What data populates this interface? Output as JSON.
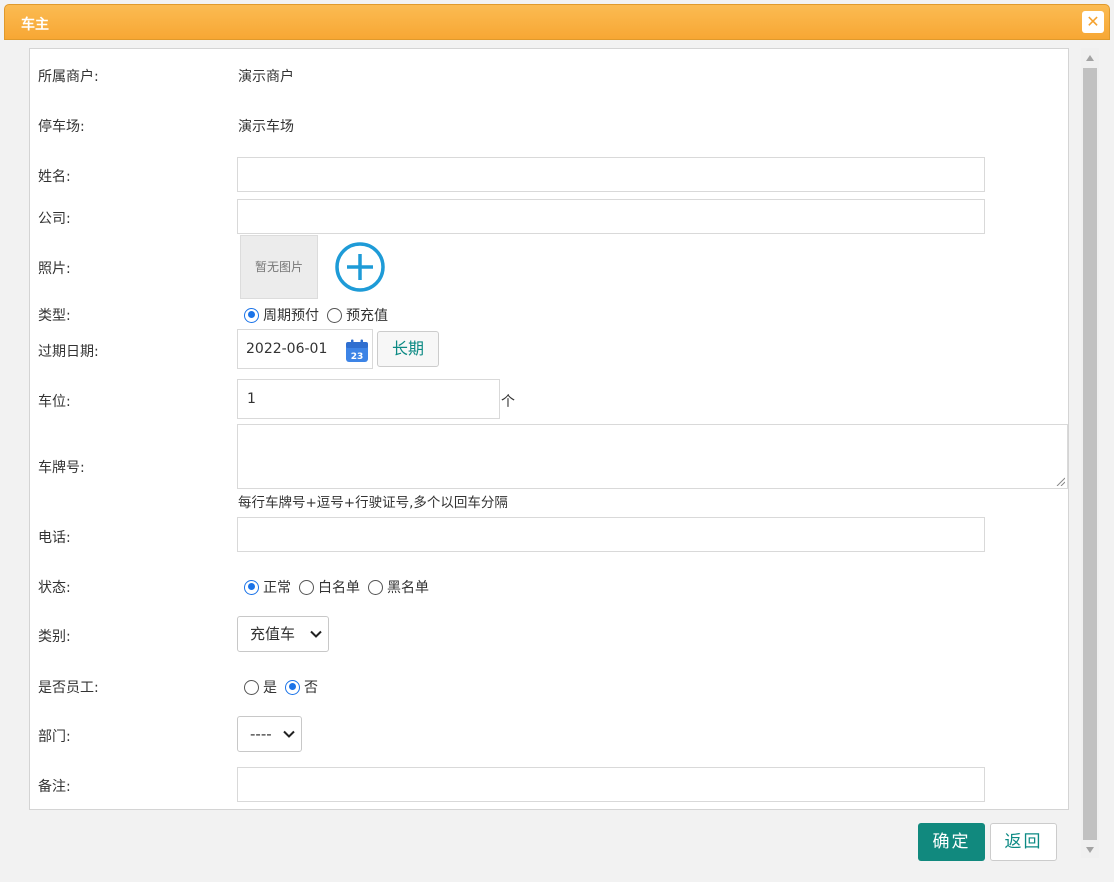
{
  "window": {
    "title": "车主",
    "close_icon": "close-icon"
  },
  "form": {
    "merchant": {
      "label": "所属商户:",
      "value": "演示商户"
    },
    "parking": {
      "label": "停车场:",
      "value": "演示车场"
    },
    "name": {
      "label": "姓名:",
      "value": ""
    },
    "company": {
      "label": "公司:",
      "value": ""
    },
    "photo": {
      "label": "照片:",
      "placeholder": "暂无图片"
    },
    "type": {
      "label": "类型:",
      "options": [
        "周期预付",
        "预充值"
      ],
      "selected": "周期预付"
    },
    "expiry": {
      "label": "过期日期:",
      "value": "2022-06-01",
      "long_term_label": "长期"
    },
    "spaces": {
      "label": "车位:",
      "value": "1",
      "unit": "个"
    },
    "plates": {
      "label": "车牌号:",
      "value": "",
      "hint": "每行车牌号+逗号+行驶证号,多个以回车分隔"
    },
    "phone": {
      "label": "电话:",
      "value": ""
    },
    "status": {
      "label": "状态:",
      "options": [
        "正常",
        "白名单",
        "黑名单"
      ],
      "selected": "正常"
    },
    "category": {
      "label": "类别:",
      "value": "充值车"
    },
    "employee": {
      "label": "是否员工:",
      "options": [
        "是",
        "否"
      ],
      "selected": "否"
    },
    "department": {
      "label": "部门:",
      "value": "----"
    },
    "remark": {
      "label": "备注:",
      "value": ""
    }
  },
  "actions": {
    "confirm_label": "确定",
    "back_label": "返回"
  },
  "colors": {
    "header": "#f7a734",
    "primary": "#11897e",
    "radio": "#1a73e8",
    "plus": "#1e9bd7"
  }
}
